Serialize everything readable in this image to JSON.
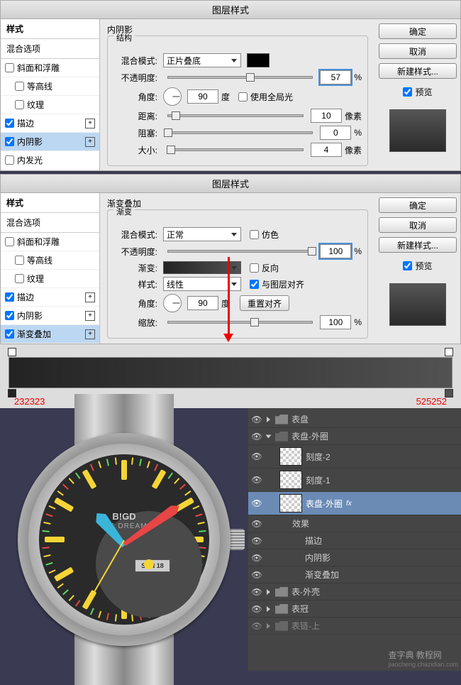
{
  "dialog1": {
    "title": "图层样式",
    "sidebar": {
      "head": "样式",
      "blend": "混合选项",
      "items": [
        {
          "label": "斜面和浮雕",
          "checked": false,
          "plus": false
        },
        {
          "label": "等高线",
          "checked": false,
          "plus": false,
          "indent": true
        },
        {
          "label": "纹理",
          "checked": false,
          "plus": false,
          "indent": true
        },
        {
          "label": "描边",
          "checked": true,
          "plus": true
        },
        {
          "label": "内阴影",
          "checked": true,
          "plus": true,
          "sel": true
        },
        {
          "label": "内发光",
          "checked": false,
          "plus": false
        }
      ]
    },
    "section": "内阴影",
    "subsection": "结构",
    "blendMode": {
      "label": "混合模式:",
      "value": "正片叠底"
    },
    "opacity": {
      "label": "不透明度:",
      "value": "57",
      "unit": "%"
    },
    "angle": {
      "label": "角度:",
      "value": "90",
      "unit": "度",
      "global": "使用全局光"
    },
    "distance": {
      "label": "距离:",
      "value": "10",
      "unit": "像素"
    },
    "choke": {
      "label": "阻塞:",
      "value": "0",
      "unit": "%"
    },
    "size": {
      "label": "大小:",
      "value": "4",
      "unit": "像素"
    },
    "buttons": {
      "ok": "确定",
      "cancel": "取消",
      "newstyle": "新建样式...",
      "preview": "预览"
    }
  },
  "dialog2": {
    "title": "图层样式",
    "sidebar": {
      "head": "样式",
      "blend": "混合选项",
      "items": [
        {
          "label": "斜面和浮雕",
          "checked": false
        },
        {
          "label": "等高线",
          "checked": false,
          "indent": true
        },
        {
          "label": "纹理",
          "checked": false,
          "indent": true
        },
        {
          "label": "描边",
          "checked": true,
          "plus": true
        },
        {
          "label": "内阴影",
          "checked": true,
          "plus": true
        },
        {
          "label": "渐变叠加",
          "checked": true,
          "plus": true,
          "sel": true
        }
      ]
    },
    "section": "渐变叠加",
    "subsection": "渐变",
    "blendMode": {
      "label": "混合模式:",
      "value": "正常",
      "dither": "仿色"
    },
    "opacity": {
      "label": "不透明度:",
      "value": "100",
      "unit": "%"
    },
    "gradient": {
      "label": "渐变:",
      "reverse": "反向"
    },
    "style": {
      "label": "样式:",
      "value": "线性",
      "align": "与图层对齐"
    },
    "angle": {
      "label": "角度:",
      "value": "90",
      "unit": "度",
      "reset": "重置对齐"
    },
    "scale": {
      "label": "缩放:",
      "value": "100",
      "unit": "%"
    },
    "buttons": {
      "ok": "确定",
      "cancel": "取消",
      "newstyle": "新建样式...",
      "preview": "预览"
    }
  },
  "gradEditor": {
    "hexLeft": "232323",
    "hexRight": "525252"
  },
  "watch": {
    "brand": "B!GD",
    "sub": "BIG DREAM",
    "date": "SUN  18"
  },
  "layers": {
    "items": [
      {
        "eye": true,
        "type": "folder",
        "label": "表盘",
        "depth": 0,
        "open": false
      },
      {
        "eye": true,
        "type": "folder",
        "label": "表盘-外圈",
        "depth": 0,
        "open": true
      },
      {
        "eye": true,
        "type": "layer",
        "label": "刻度-2",
        "depth": 1
      },
      {
        "eye": true,
        "type": "layer",
        "label": "刻度-1",
        "depth": 1
      },
      {
        "eye": true,
        "type": "layer",
        "label": "表盘-外圈",
        "depth": 1,
        "sel": true,
        "fx": true
      },
      {
        "eye": true,
        "type": "fx",
        "label": "效果",
        "depth": 2
      },
      {
        "eye": true,
        "type": "fx",
        "label": "描边",
        "depth": 3
      },
      {
        "eye": true,
        "type": "fx",
        "label": "内阴影",
        "depth": 3
      },
      {
        "eye": true,
        "type": "fx",
        "label": "渐变叠加",
        "depth": 3
      },
      {
        "eye": true,
        "type": "folder",
        "label": "表-外壳",
        "depth": 0,
        "open": false
      },
      {
        "eye": true,
        "type": "folder",
        "label": "表冠",
        "depth": 0,
        "open": false
      },
      {
        "eye": true,
        "type": "folder",
        "label": "表链-上",
        "depth": 0,
        "open": false,
        "dim": true
      }
    ]
  },
  "watermark": {
    "main": "查字典 教程网",
    "sub": "jiaocheng.chazidian.com"
  },
  "chart_data": null
}
